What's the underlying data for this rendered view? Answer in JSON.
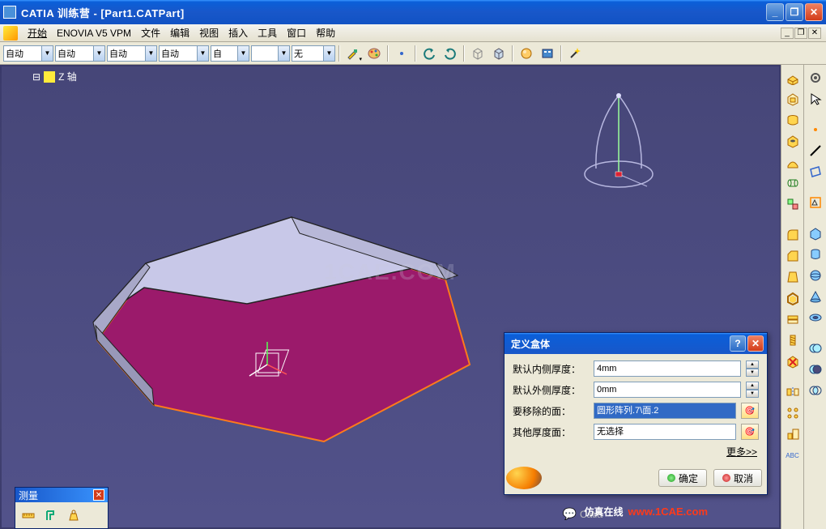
{
  "window": {
    "title": "CATIA 训练营 - [Part1.CATPart]"
  },
  "menu": {
    "start": "开始",
    "enovia": "ENOVIA V5 VPM",
    "file": "文件",
    "edit": "编辑",
    "view": "视图",
    "insert": "插入",
    "tools": "工具",
    "window": "窗口",
    "help": "帮助"
  },
  "toolbar": {
    "combo1": "自动",
    "combo2": "自动",
    "combo3": "自动",
    "combo4": "自动",
    "combo5": "自",
    "combo6": "",
    "combo7": "无"
  },
  "tree": {
    "z_axis": "Z 轴"
  },
  "dialog": {
    "title": "定义盒体",
    "row1_label": "默认内侧厚度：",
    "row1_value": "4mm",
    "row2_label": "默认外侧厚度：",
    "row2_value": "0mm",
    "row3_label": "要移除的面：",
    "row3_value": "圆形阵列.7\\面.2",
    "row4_label": "其他厚度面：",
    "row4_value": "无选择",
    "more": "更多>>",
    "ok": "确定",
    "cancel": "取消"
  },
  "measure": {
    "title": "测量"
  },
  "watermarks": {
    "center": "1CAE.COM",
    "brand": "仿真在线",
    "url": "www.1CAE.com",
    "wx": "Catia"
  }
}
